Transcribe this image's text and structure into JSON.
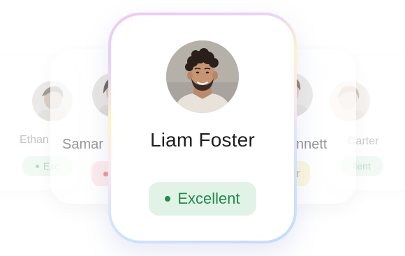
{
  "cards": {
    "far_left": {
      "name": "Ethan",
      "badge": "Exc"
    },
    "mid_left": {
      "name": "Samar",
      "badge": ""
    },
    "main": {
      "name": "Liam Foster",
      "badge": "Excellent"
    },
    "mid_right": {
      "name": "nnett",
      "badge": "r"
    },
    "far_right": {
      "name": "Carter",
      "badge": "llent"
    }
  },
  "colors": {
    "excellent_bg": "#e2f3e8",
    "excellent_text": "#2f8f55",
    "poor_bg": "#fde4e4",
    "poor_dot": "#e06a6a",
    "fair_bg": "#fbf6d8",
    "name_main": "#222222",
    "name_side": "#777777"
  }
}
